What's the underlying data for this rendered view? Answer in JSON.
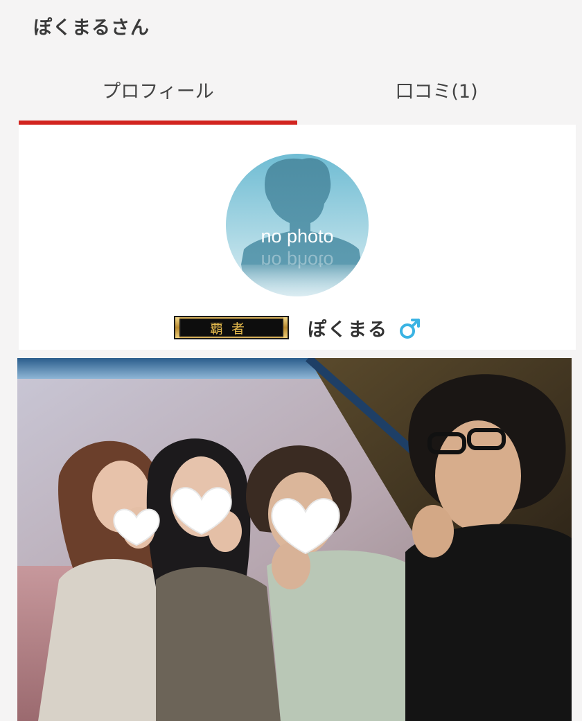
{
  "header": {
    "title": "ぽくまるさん"
  },
  "tabs": [
    {
      "label": "プロフィール",
      "active": true
    },
    {
      "label": "口コミ(1)",
      "active": false
    }
  ],
  "colors": {
    "accent": "#d2241f",
    "gender_male": "#3ab3e3",
    "badge_gold": "#d9b24a"
  },
  "profile": {
    "avatar_text": "no photo",
    "rank_badge_text": "覇者",
    "name": "ぽくまる",
    "gender_symbol": "♂",
    "gender_icon": "male-symbol-icon"
  }
}
